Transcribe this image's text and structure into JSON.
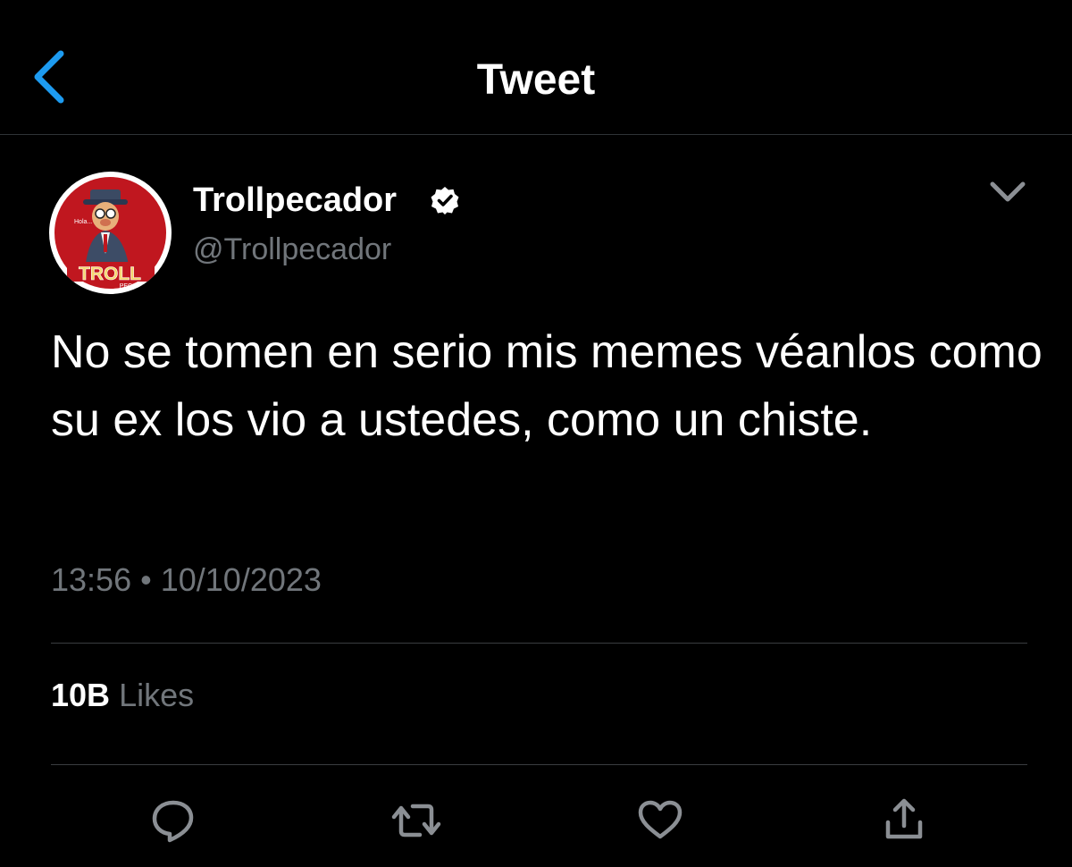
{
  "header": {
    "title": "Tweet",
    "back_icon": "chevron-left-icon"
  },
  "tweet": {
    "author": {
      "display_name": "Trollpecador",
      "handle": "@Trollpecador",
      "verified": true,
      "avatar_text": "TROLL",
      "avatar_subtext": "PECADOR"
    },
    "text": "No se tomen en serio mis memes véanlos como su ex los vio a ustedes, como un chiste.",
    "time": "13:56",
    "separator": "•",
    "date": "10/10/2023",
    "stats": {
      "likes_count": "10B",
      "likes_label": "Likes"
    }
  },
  "actions": [
    {
      "name": "reply",
      "icon": "reply-icon"
    },
    {
      "name": "retweet",
      "icon": "retweet-icon"
    },
    {
      "name": "like",
      "icon": "heart-icon"
    },
    {
      "name": "share",
      "icon": "share-icon"
    }
  ],
  "colors": {
    "background": "#000000",
    "text_primary": "#ffffff",
    "text_secondary": "#71767b",
    "accent": "#1d9bf0",
    "divider": "#3a3d40",
    "avatar_red": "#c0171f"
  }
}
